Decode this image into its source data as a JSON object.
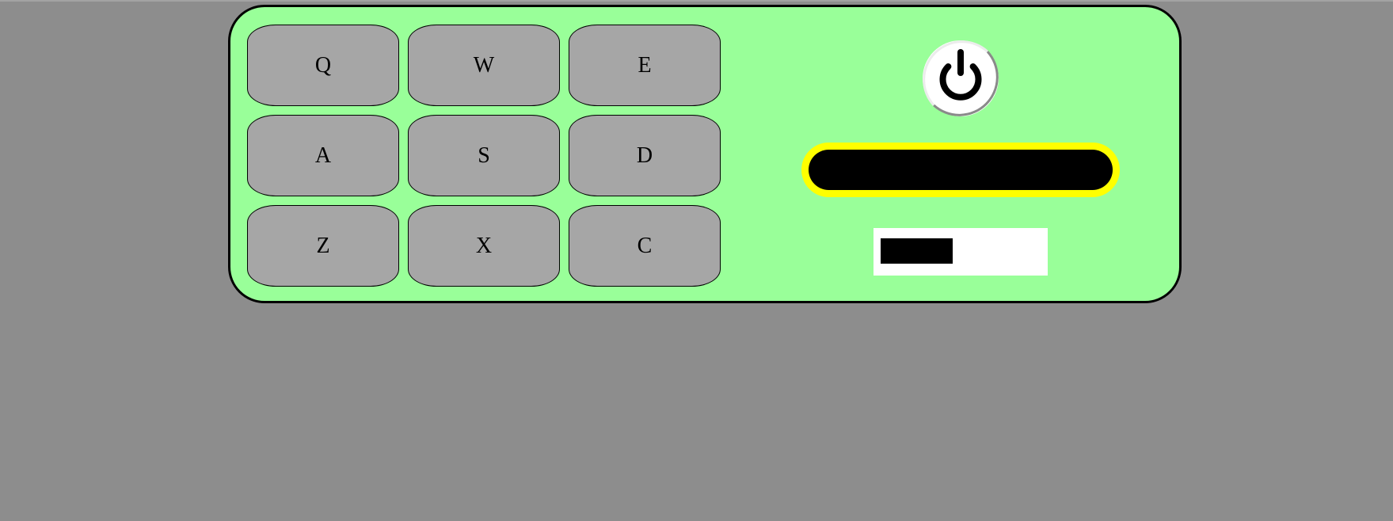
{
  "colors": {
    "background": "#8d8d8d",
    "panel": "#99ff99",
    "key": "#a6a6a6",
    "display_border": "#ffff00",
    "display": "#000000",
    "level_track": "#ffffff",
    "level_fill": "#000000"
  },
  "keypad": {
    "keys": [
      {
        "label": "Q"
      },
      {
        "label": "W"
      },
      {
        "label": "E"
      },
      {
        "label": "A"
      },
      {
        "label": "S"
      },
      {
        "label": "D"
      },
      {
        "label": "Z"
      },
      {
        "label": "X"
      },
      {
        "label": "C"
      }
    ]
  },
  "power_button": {
    "icon": "power-icon"
  },
  "level_indicator": {
    "fraction": 0.45
  }
}
